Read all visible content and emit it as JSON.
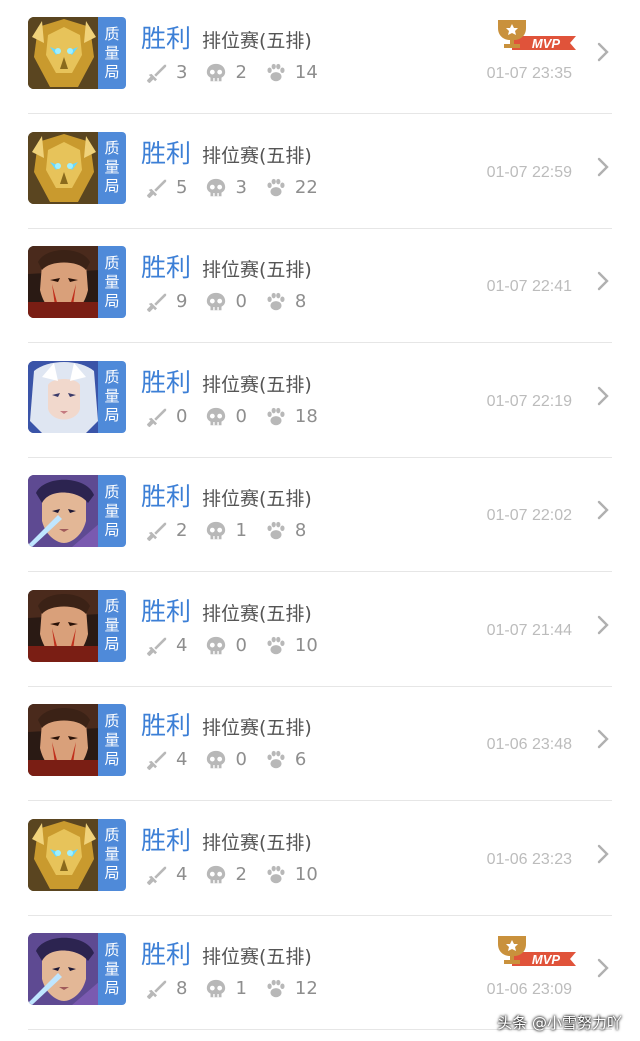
{
  "badge_chars": [
    "质",
    "量",
    "局"
  ],
  "matches": [
    {
      "result": "胜利",
      "mode": "排位赛(五排)",
      "kills": "3",
      "deaths": "2",
      "assists": "14",
      "time": "01-07 23:35",
      "mvp": true,
      "mvp_label": "MVP",
      "hero": "golden-knight-avatar"
    },
    {
      "result": "胜利",
      "mode": "排位赛(五排)",
      "kills": "5",
      "deaths": "3",
      "assists": "22",
      "time": "01-07 22:59",
      "mvp": false,
      "hero": "golden-knight-avatar"
    },
    {
      "result": "胜利",
      "mode": "排位赛(五排)",
      "kills": "9",
      "deaths": "0",
      "assists": "8",
      "time": "01-07 22:41",
      "mvp": false,
      "hero": "red-warrior-avatar"
    },
    {
      "result": "胜利",
      "mode": "排位赛(五排)",
      "kills": "0",
      "deaths": "0",
      "assists": "18",
      "time": "01-07 22:19",
      "mvp": false,
      "hero": "white-hair-mage-avatar"
    },
    {
      "result": "胜利",
      "mode": "排位赛(五排)",
      "kills": "2",
      "deaths": "1",
      "assists": "8",
      "time": "01-07 22:02",
      "mvp": false,
      "hero": "purple-swordsman-avatar"
    },
    {
      "result": "胜利",
      "mode": "排位赛(五排)",
      "kills": "4",
      "deaths": "0",
      "assists": "10",
      "time": "01-07 21:44",
      "mvp": false,
      "hero": "red-warrior-avatar"
    },
    {
      "result": "胜利",
      "mode": "排位赛(五排)",
      "kills": "4",
      "deaths": "0",
      "assists": "6",
      "time": "01-06 23:48",
      "mvp": false,
      "hero": "red-warrior-avatar"
    },
    {
      "result": "胜利",
      "mode": "排位赛(五排)",
      "kills": "4",
      "deaths": "2",
      "assists": "10",
      "time": "01-06 23:23",
      "mvp": false,
      "hero": "golden-knight-avatar"
    },
    {
      "result": "胜利",
      "mode": "排位赛(五排)",
      "kills": "8",
      "deaths": "1",
      "assists": "12",
      "time": "01-06 23:09",
      "mvp": true,
      "mvp_label": "MVP",
      "hero": "purple-swordsman-avatar"
    }
  ],
  "colors": {
    "result_blue": "#3c7fd6",
    "badge_blue": "#4f8ad9",
    "stat_gray": "#8e8e8e",
    "time_gray": "#bcbcbc",
    "mvp_red": "#e0533a",
    "mvp_gold": "#c9913c"
  },
  "icons": {
    "kills": "sword-icon",
    "deaths": "skull-icon",
    "assists": "paw-icon",
    "row_action": "chevron-right-icon",
    "mvp": "trophy-icon"
  },
  "watermark": "头条 @小雪努力吖"
}
